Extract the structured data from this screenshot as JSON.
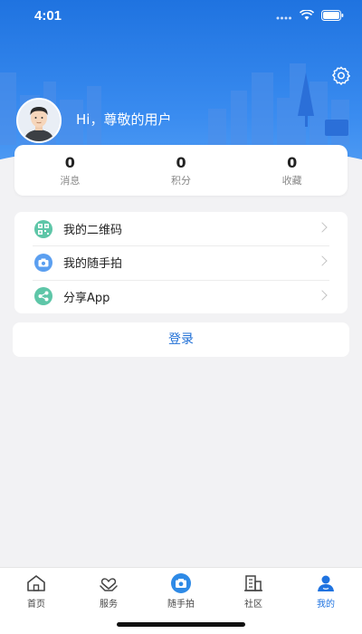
{
  "status": {
    "time": "4:01"
  },
  "profile": {
    "greeting": "Hi，尊敬的用户"
  },
  "stats": [
    {
      "value": "0",
      "label": "消息"
    },
    {
      "value": "0",
      "label": "积分"
    },
    {
      "value": "0",
      "label": "收藏"
    }
  ],
  "menu": [
    {
      "label": "我的二维码",
      "icon": "qr-code-icon"
    },
    {
      "label": "我的随手拍",
      "icon": "camera-icon"
    },
    {
      "label": "分享App",
      "icon": "share-icon"
    }
  ],
  "login": {
    "label": "登录"
  },
  "tabs": [
    {
      "label": "首页",
      "icon": "home-icon"
    },
    {
      "label": "服务",
      "icon": "heart-hands-icon"
    },
    {
      "label": "随手拍",
      "icon": "camera-icon"
    },
    {
      "label": "社区",
      "icon": "building-icon"
    },
    {
      "label": "我的",
      "icon": "user-icon",
      "active": true
    }
  ],
  "colors": {
    "primary": "#1f73e0",
    "menu_icon_green": "#5ec6a8",
    "menu_icon_blue": "#5b9ff0"
  }
}
